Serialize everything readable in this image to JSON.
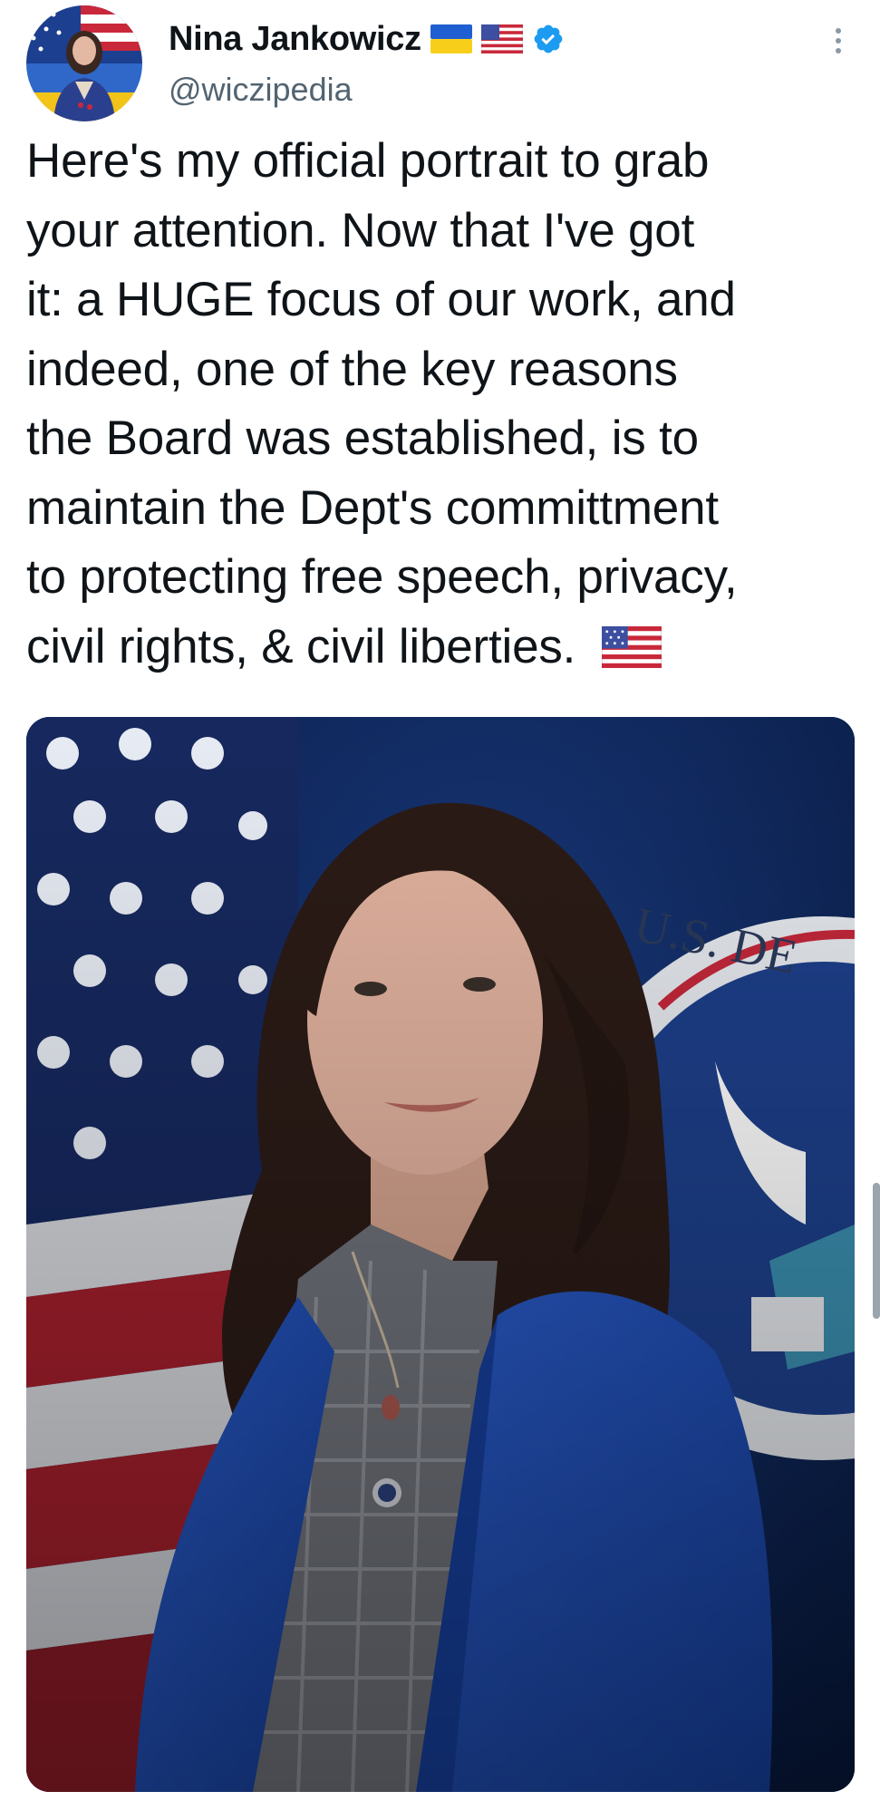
{
  "author": {
    "display_name": "Nina Jankowicz",
    "handle": "@wiczipedia",
    "name_emoji": [
      "ukraine-flag",
      "us-flag"
    ],
    "verified": true,
    "verified_color": "#1d9bf0"
  },
  "tweet": {
    "lines": [
      "Here's my official portrait to grab",
      "your attention. Now that I've got",
      "it: a HUGE focus of our work, and",
      "indeed, one of the key reasons",
      "the Board was established, is to",
      "maintain the Dept's committment",
      "to protecting free speech, privacy,",
      "civil rights, & civil liberties."
    ],
    "trailing_emoji": "us-flag"
  },
  "media": {
    "type": "photo",
    "seal_text": "U.S. DE"
  },
  "colors": {
    "text": "#0f1419",
    "secondary": "#536471",
    "blazer": "#1f4fb8"
  }
}
